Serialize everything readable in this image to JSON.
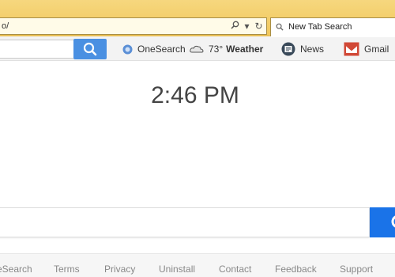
{
  "browser": {
    "address_text": "o/",
    "tab_title": "New Tab Search"
  },
  "toolbar": {
    "items": [
      {
        "label": "OneSearch",
        "icon": "onesearch-icon"
      },
      {
        "temp": "73°",
        "label": "Weather",
        "icon": "cloud-icon"
      },
      {
        "label": "News",
        "icon": "news-icon"
      },
      {
        "label": "Gmail",
        "icon": "gmail-icon"
      }
    ]
  },
  "clock": {
    "time": "2:46 PM"
  },
  "footer": {
    "links": [
      "eSearch",
      "Terms",
      "Privacy",
      "Uninstall",
      "Contact",
      "Feedback",
      "Support"
    ]
  },
  "colors": {
    "chrome": "#f1c75a",
    "search_button": "#4a90e2",
    "main_search_button": "#1a73e8",
    "footer_text": "#888888"
  }
}
